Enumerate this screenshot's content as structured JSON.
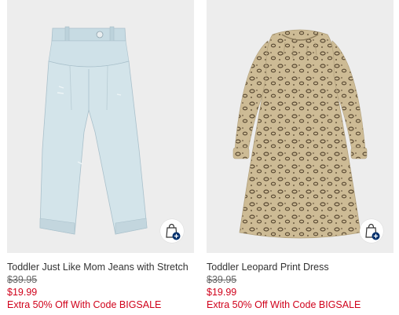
{
  "products": [
    {
      "name": "Toddler Just Like Mom Jeans with Stretch",
      "original_price": "$39.95",
      "sale_price": "$19.99",
      "promo": "Extra 50% Off With Code BIGSALE",
      "image_icon": "jeans-image",
      "bag_icon": "add-to-bag-icon"
    },
    {
      "name": "Toddler Leopard Print Dress",
      "original_price": "$39.95",
      "sale_price": "$19.99",
      "promo": "Extra 50% Off With Code BIGSALE",
      "image_icon": "dress-image",
      "bag_icon": "add-to-bag-icon"
    }
  ],
  "colors": {
    "image_bg": "#ededed",
    "sale": "#d0021b",
    "text": "#333333",
    "bag_plus": "#002f6c"
  }
}
